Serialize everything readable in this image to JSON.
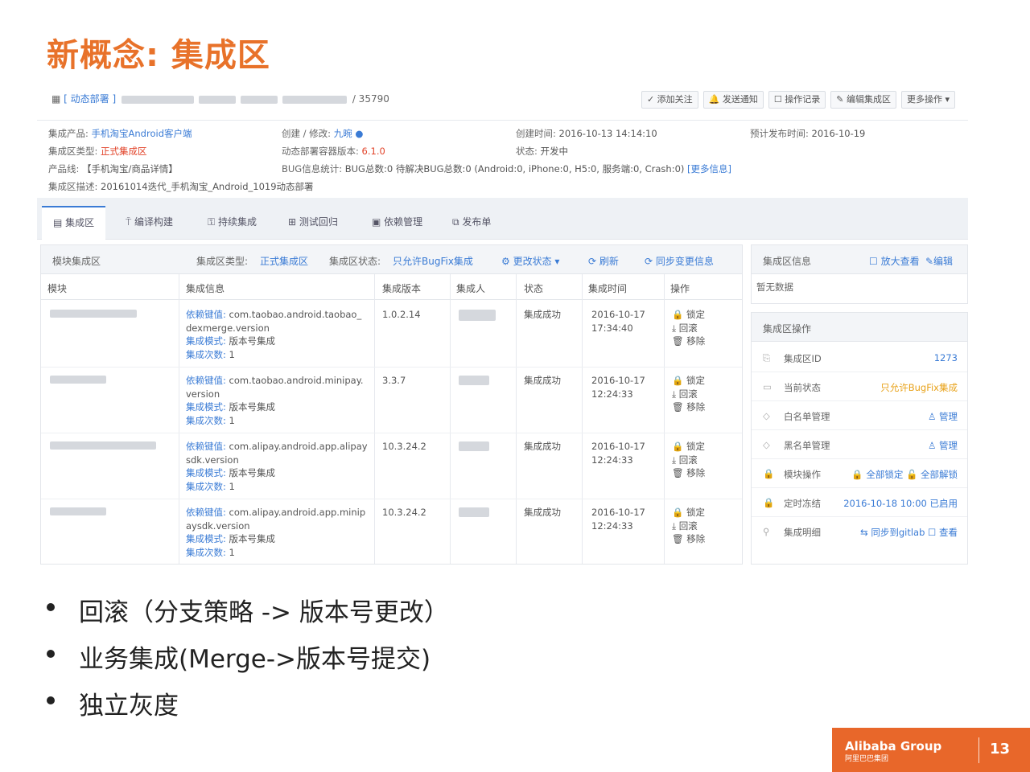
{
  "slide": {
    "title": "新概念: 集成区",
    "bullets": [
      "回滚（分支策略 -> 版本号更改）",
      "业务集成(Merge->版本号提交)",
      "独立灰度"
    ],
    "page_number": "13",
    "logo_text": "Alibaba Group",
    "logo_sub": "阿里巴巴集团"
  },
  "header": {
    "crumb_link": "[ 动态部署 ]",
    "crumb_tail": "/ 35790",
    "buttons": [
      "✓ 添加关注",
      "🔔 发送通知",
      "☐ 操作记录",
      "✎ 编辑集成区",
      "更多操作 ▾"
    ]
  },
  "meta": {
    "product_label": "集成产品:",
    "product_value": "手机淘宝Android客户端",
    "type_label": "集成区类型:",
    "type_value": "正式集成区",
    "line_label": "产品线:",
    "line_value": "【手机淘宝/商品详情】",
    "desc_label": "集成区描述:",
    "desc_value": "20161014迭代_手机淘宝_Android_1019动态部署",
    "creator_label": "创建 / 修改:",
    "creator_value": "九晼",
    "container_label": "动态部署容器版本:",
    "container_value": "6.1.0",
    "bug_label": "BUG信息统计:",
    "bug_value": "BUG总数:0  待解决BUG总数:0 (Android:0, iPhone:0, H5:0, 服务端:0, Crash:0)",
    "bug_more": "[更多信息]",
    "created_label": "创建时间:",
    "created_value": "2016-10-13 14:14:10",
    "state_label": "状态:",
    "state_value": "开发中",
    "release_label": "预计发布时间:",
    "release_value": "2016-10-19"
  },
  "tabs": [
    "集成区",
    "编译构建",
    "持续集成",
    "测试回归",
    "依赖管理",
    "发布单"
  ],
  "module_panel": {
    "title": "模块集成区",
    "type_label": "集成区类型:",
    "type_value": "正式集成区",
    "state_label": "集成区状态:",
    "state_value": "只允许BugFix集成",
    "change_state": "⚙ 更改状态 ▾",
    "refresh": "⟳ 刷新",
    "sync": "⟳ 同步变更信息",
    "columns": [
      "模块",
      "集成信息",
      "集成版本",
      "集成人",
      "状态",
      "集成时间",
      "操作"
    ],
    "ops": [
      "🔒 锁定",
      "⤓ 回滚",
      "🗑 移除"
    ],
    "rows": [
      {
        "key_label": "依赖键值:",
        "key1": "com.taobao.android.taobao_",
        "key2": "dexmerge.version",
        "mode_label": "集成模式:",
        "mode": "版本号集成",
        "count_label": "集成次数:",
        "count": "1",
        "version": "1.0.2.14",
        "status": "集成成功",
        "date": "2016-10-17",
        "time": "17:34:40"
      },
      {
        "key_label": "依赖键值:",
        "key1": "com.taobao.android.minipay.",
        "key2": "version",
        "mode_label": "集成模式:",
        "mode": "版本号集成",
        "count_label": "集成次数:",
        "count": "1",
        "version": "3.3.7",
        "status": "集成成功",
        "date": "2016-10-17",
        "time": "12:24:33"
      },
      {
        "key_label": "依赖键值:",
        "key1": "com.alipay.android.app.alipay",
        "key2": "sdk.version",
        "mode_label": "集成模式:",
        "mode": "版本号集成",
        "count_label": "集成次数:",
        "count": "1",
        "version": "10.3.24.2",
        "status": "集成成功",
        "date": "2016-10-17",
        "time": "12:24:33"
      },
      {
        "key_label": "依赖键值:",
        "key1": "com.alipay.android.app.minip",
        "key2": "aysdk.version",
        "mode_label": "集成模式:",
        "mode": "版本号集成",
        "count_label": "集成次数:",
        "count": "1",
        "version": "10.3.24.2",
        "status": "集成成功",
        "date": "2016-10-17",
        "time": "12:24:33"
      }
    ]
  },
  "info_panel": {
    "title": "集成区信息",
    "zoom": "☐ 放大查看",
    "edit": "✎编辑",
    "empty": "暂无数据"
  },
  "ops_panel": {
    "title": "集成区操作",
    "rows": [
      {
        "icon": "⎘",
        "label": "集成区ID",
        "value": "1273"
      },
      {
        "icon": "▭",
        "label": "当前状态",
        "value": "只允许BugFix集成"
      },
      {
        "icon": "◇",
        "label": "白名单管理",
        "value": "♙ 管理"
      },
      {
        "icon": "◇",
        "label": "黑名单管理",
        "value": "♙ 管理"
      },
      {
        "icon": "🔒",
        "label": "模块操作",
        "value": "🔒 全部锁定  🔓 全部解锁"
      },
      {
        "icon": "🔒",
        "label": "定时冻结",
        "value": "2016-10-18 10:00   已启用"
      },
      {
        "icon": "⚲",
        "label": "集成明细",
        "value": "⇆ 同步到gitlab  ☐ 查看"
      }
    ]
  },
  "colors": {
    "accent": "#e8722a",
    "link": "#3a7bd5",
    "success": "#6cc36c",
    "danger": "#e2452b",
    "warn": "#e8a21a"
  }
}
